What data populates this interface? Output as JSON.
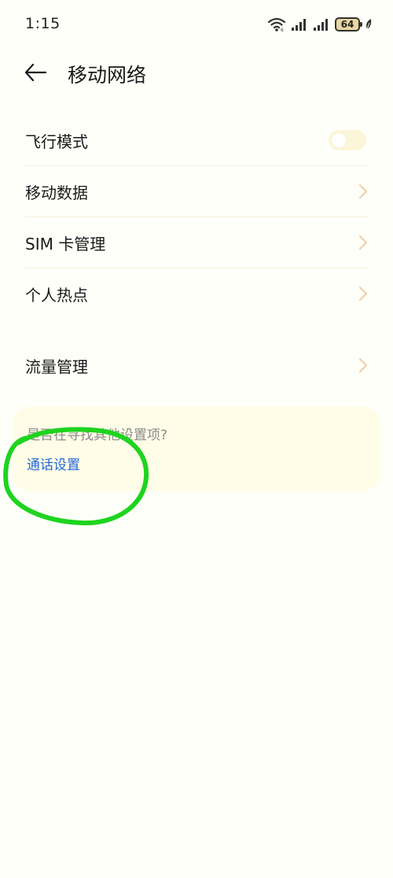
{
  "status_bar": {
    "time": "1:15",
    "battery": "64",
    "icons": [
      "wifi-icon",
      "signal-icon",
      "signal-icon",
      "battery-icon",
      "leaf-icon"
    ]
  },
  "header": {
    "title": "移动网络",
    "back_icon": "arrow-left-icon"
  },
  "settings": {
    "items": [
      {
        "label": "飞行模式",
        "control": "toggle",
        "checked": false
      },
      {
        "label": "移动数据",
        "control": "chevron"
      },
      {
        "label": "SIM 卡管理",
        "control": "chevron"
      },
      {
        "label": "个人热点",
        "control": "chevron"
      },
      {
        "label": "流量管理",
        "control": "chevron"
      }
    ]
  },
  "suggestion": {
    "title": "是否在寻找其他设置项?",
    "link": "通话设置"
  },
  "colors": {
    "background": "#fffffa",
    "link": "#2469d9",
    "chevron": "#f0cfa8",
    "card": "#fffde8",
    "annotation": "#1ed41e"
  }
}
